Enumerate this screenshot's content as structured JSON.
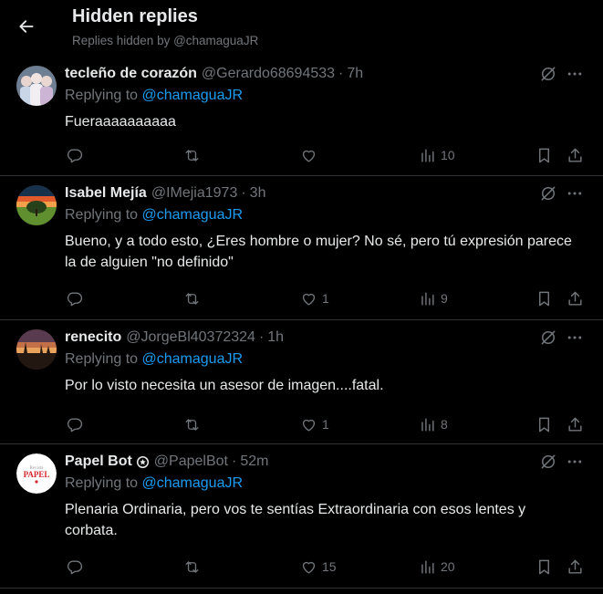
{
  "header": {
    "title": "Hidden replies",
    "subtitle": "Replies hidden by @chamaguaJR"
  },
  "tweets": [
    {
      "name": "tecleño de corazón",
      "handle": "@Gerardo68694533",
      "time": "7h",
      "replying_prefix": "Replying to",
      "replying_to": "@chamaguaJR",
      "text": "Fueraaaaaaaaaa",
      "likes": "",
      "views": "10",
      "avatar": "avatar-group-photo"
    },
    {
      "name": "Isabel Mejía",
      "handle": "@IMejia1973",
      "time": "3h",
      "replying_prefix": "Replying to",
      "replying_to": "@chamaguaJR",
      "text": "Bueno, y a todo esto, ¿Eres hombre o mujer? No sé, pero tú expresión parece la de alguien \"no definido\"",
      "likes": "1",
      "views": "9",
      "avatar": "avatar-sunset-tree"
    },
    {
      "name": "renecito",
      "handle": "@JorgeBl40372324",
      "time": "1h",
      "replying_prefix": "Replying to",
      "replying_to": "@chamaguaJR",
      "text": "Por lo visto necesita un asesor de imagen....fatal.",
      "likes": "1",
      "views": "8",
      "avatar": "avatar-dusk-silhouette"
    },
    {
      "name": "Papel Bot",
      "handle": "@PapelBot",
      "time": "52m",
      "replying_prefix": "Replying to",
      "replying_to": "@chamaguaJR",
      "text": "Plenaria Ordinaria, pero vos te sentías Extraordinaria con esos lentes y corbata.",
      "likes": "15",
      "views": "20",
      "avatar": "avatar-revista-papel-logo",
      "avatar_logo_text": {
        "top": "Revista",
        "main": "PAPEL"
      }
    }
  ],
  "colors": {
    "background": "#000000",
    "text": "#e7e9ea",
    "muted": "#71767b",
    "link": "#1d9bf0",
    "divider": "#2f3336"
  },
  "icons": {
    "back": "arrow-left-icon",
    "unhide": "unhide-reply-icon",
    "more": "more-dots-icon",
    "reply": "reply-bubble-icon",
    "retweet": "retweet-icon",
    "like": "heart-icon",
    "views": "views-chart-icon",
    "bookmark": "bookmark-icon",
    "share": "share-icon",
    "verified": "automated-badge-icon"
  }
}
